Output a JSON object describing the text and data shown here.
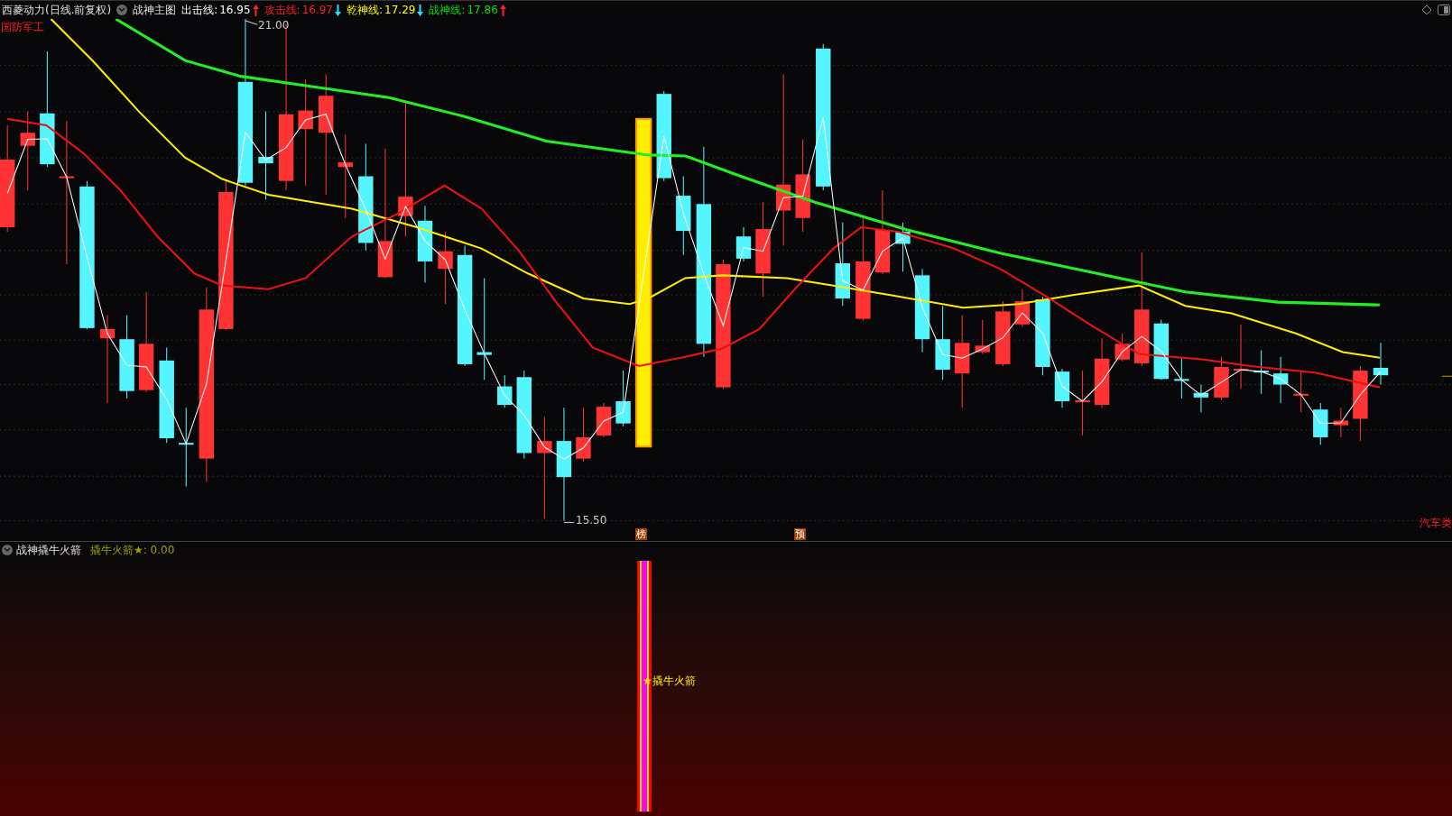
{
  "header": {
    "stock": "西菱动力(日线.前复权)",
    "indicator": "战神主图",
    "lines": [
      {
        "label": "出击线:",
        "value": "16.95",
        "arrow": {
          "kind": "up",
          "color": "#ff2020"
        },
        "color": "#ffffff"
      },
      {
        "label": "攻击线:",
        "value": "16.97",
        "arrow": {
          "kind": "down",
          "color": "#30e0f0"
        },
        "color": "#ff2020"
      },
      {
        "label": "乾神线:",
        "value": "17.29",
        "arrow": {
          "kind": "down",
          "color": "#30e0f0"
        },
        "color": "#ffff00"
      },
      {
        "label": "战神线:",
        "value": "17.86",
        "arrow": {
          "kind": "up",
          "color": "#ff2020"
        },
        "color": "#00e000"
      }
    ]
  },
  "main_chart": {
    "sector_tag": "国防军工",
    "high_label": "21.00",
    "low_label": "15.50",
    "markers": [
      {
        "text": "榜"
      },
      {
        "text": "预"
      }
    ],
    "right_tag": "汽车类"
  },
  "sub_chart": {
    "title": "战神撬牛火箭",
    "reading": "撬牛火箭★: 0.00",
    "signal_label": "★撬牛火箭"
  }
}
